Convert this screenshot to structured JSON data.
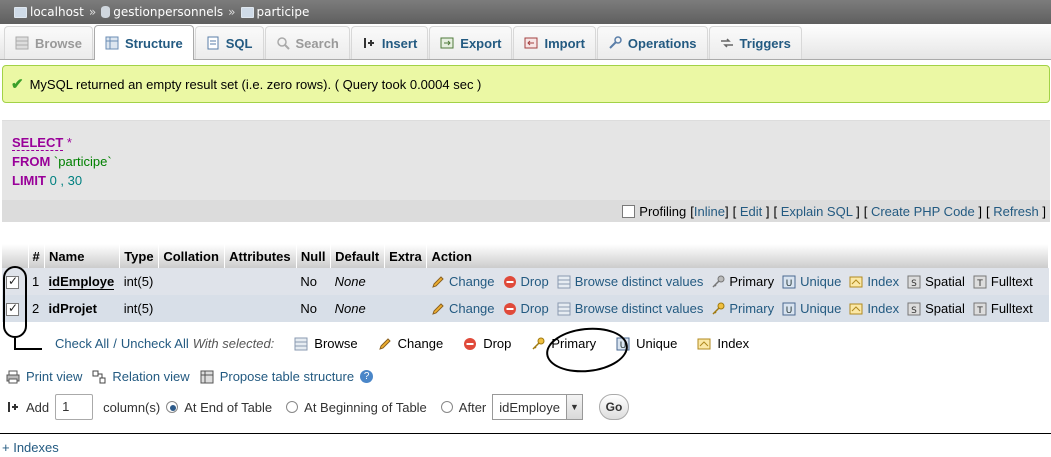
{
  "breadcrumb": {
    "server": "localhost",
    "database": "gestionpersonnels",
    "table": "participe",
    "separator": "»"
  },
  "tabs": [
    {
      "label": "Browse",
      "icon": "browse-icon",
      "state": "disabled"
    },
    {
      "label": "Structure",
      "icon": "structure-icon",
      "state": "active"
    },
    {
      "label": "SQL",
      "icon": "sql-icon",
      "state": "normal"
    },
    {
      "label": "Search",
      "icon": "search-icon",
      "state": "disabled"
    },
    {
      "label": "Insert",
      "icon": "insert-icon",
      "state": "normal"
    },
    {
      "label": "Export",
      "icon": "export-icon",
      "state": "normal"
    },
    {
      "label": "Import",
      "icon": "import-icon",
      "state": "normal"
    },
    {
      "label": "Operations",
      "icon": "operations-icon",
      "state": "normal"
    },
    {
      "label": "Triggers",
      "icon": "triggers-icon",
      "state": "normal"
    }
  ],
  "message": "MySQL returned an empty result set (i.e. zero rows). ( Query took 0.0004 sec )",
  "sql": {
    "select": "SELECT",
    "star": "*",
    "from": "FROM",
    "table": "`participe`",
    "limit": "LIMIT",
    "offset": "0",
    "comma": ",",
    "count": "30"
  },
  "sql_toolbar": {
    "profiling": "Profiling",
    "inline": "Inline",
    "edit": "Edit",
    "explain": "Explain SQL",
    "php": "Create PHP Code",
    "refresh": "Refresh"
  },
  "table": {
    "headers": [
      "#",
      "Name",
      "Type",
      "Collation",
      "Attributes",
      "Null",
      "Default",
      "Extra",
      "Action"
    ],
    "rows": [
      {
        "num": "1",
        "name": "idEmploye",
        "type": "int(5)",
        "collation": "",
        "attributes": "",
        "null": "No",
        "default": "None",
        "extra": "",
        "checked": true
      },
      {
        "num": "2",
        "name": "idProjet",
        "type": "int(5)",
        "collation": "",
        "attributes": "",
        "null": "No",
        "default": "None",
        "extra": "",
        "checked": true
      }
    ],
    "actions": {
      "change": "Change",
      "drop": "Drop",
      "browse_distinct": "Browse distinct values",
      "primary": "Primary",
      "unique": "Unique",
      "index": "Index",
      "spatial": "Spatial",
      "fulltext": "Fulltext"
    }
  },
  "with_selected": {
    "check_all": "Check All",
    "slash": "/",
    "uncheck_all": "Uncheck All",
    "label": "With selected:",
    "browse": "Browse",
    "change": "Change",
    "drop": "Drop",
    "primary": "Primary",
    "unique": "Unique",
    "index": "Index"
  },
  "links": {
    "print_view": "Print view",
    "relation_view": "Relation view",
    "propose": "Propose table structure"
  },
  "add_column": {
    "add": "Add",
    "count": "1",
    "columns_label": "column(s)",
    "end": "At End of Table",
    "beginning": "At Beginning of Table",
    "after": "After",
    "after_field": "idEmploye",
    "go": "Go"
  },
  "indexes_link": "+ Indexes",
  "colors": {
    "link": "#235a81",
    "keyword": "#990099",
    "success_bg": "#ebf8a4",
    "success_border": "#a2d246"
  }
}
